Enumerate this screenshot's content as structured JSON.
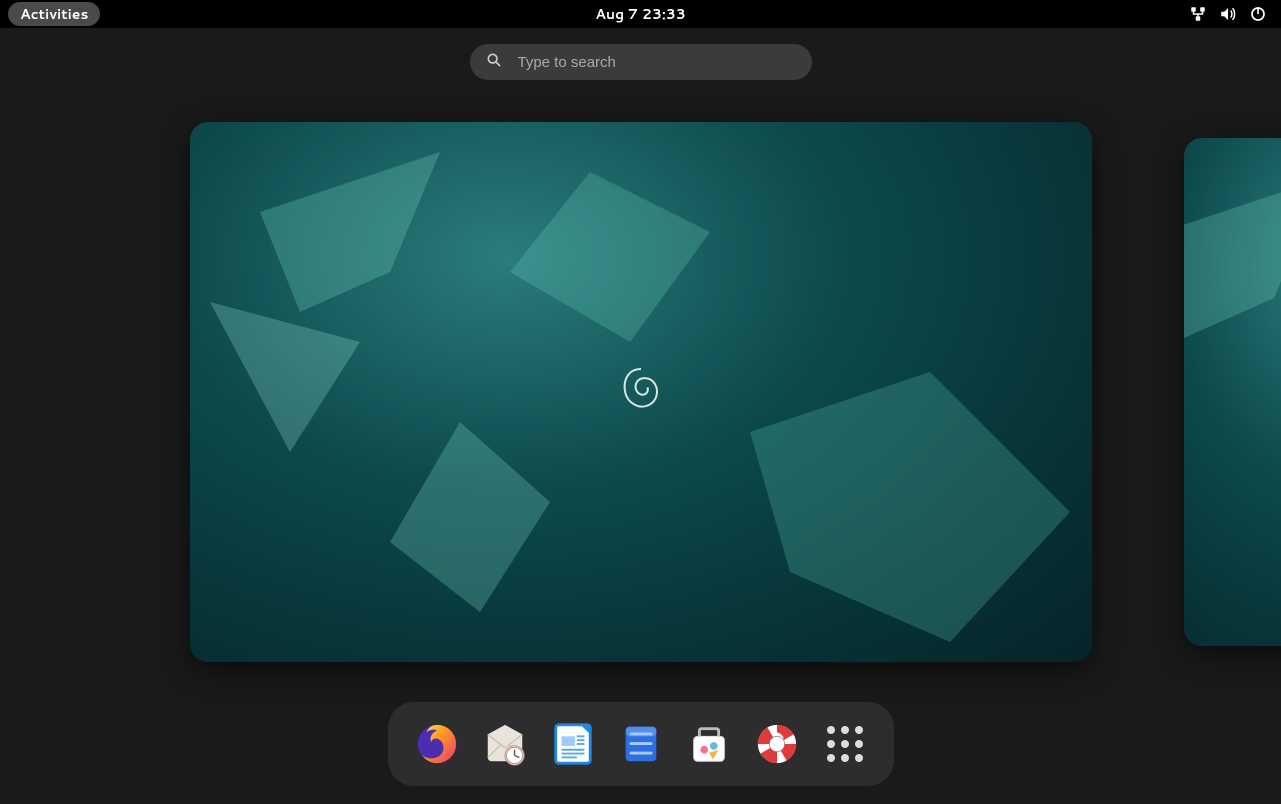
{
  "topbar": {
    "activities_label": "Activities",
    "clock": "Aug 7  23:33"
  },
  "search": {
    "placeholder": "Type to search",
    "value": ""
  },
  "dash": {
    "apps": [
      {
        "id": "firefox",
        "name": "Firefox"
      },
      {
        "id": "evolution",
        "name": "Evolution Mail"
      },
      {
        "id": "writer",
        "name": "LibreOffice Writer"
      },
      {
        "id": "files",
        "name": "Files"
      },
      {
        "id": "software",
        "name": "Software"
      },
      {
        "id": "help",
        "name": "Help"
      },
      {
        "id": "appgrid",
        "name": "Show Applications"
      }
    ]
  },
  "status_icons": [
    {
      "id": "network",
      "name": "Wired Network"
    },
    {
      "id": "volume",
      "name": "Volume"
    },
    {
      "id": "power",
      "name": "Power"
    }
  ],
  "workspaces": {
    "count": 2,
    "active_index": 0
  }
}
